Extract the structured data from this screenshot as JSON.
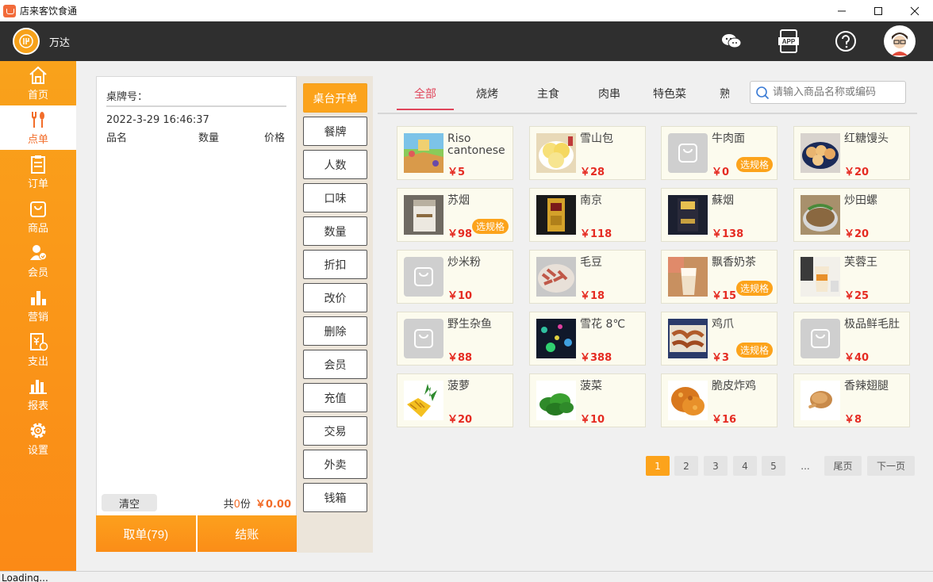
{
  "window": {
    "title": "店来客饮食通"
  },
  "header": {
    "store_name": "万达",
    "icons": [
      "wechat-icon",
      "app-icon",
      "help-icon",
      "avatar"
    ]
  },
  "sidebar": {
    "items": [
      {
        "label": "首页",
        "icon": "home-icon"
      },
      {
        "label": "点单",
        "icon": "cutlery-icon",
        "active": true
      },
      {
        "label": "订单",
        "icon": "clipboard-icon"
      },
      {
        "label": "商品",
        "icon": "bag-icon"
      },
      {
        "label": "会员",
        "icon": "member-icon"
      },
      {
        "label": "营销",
        "icon": "marketing-icon"
      },
      {
        "label": "支出",
        "icon": "expense-icon"
      },
      {
        "label": "报表",
        "icon": "report-icon"
      },
      {
        "label": "设置",
        "icon": "gear-icon"
      }
    ]
  },
  "order": {
    "table_label": "桌牌号：",
    "datetime": "2022-3-29 16:46:37",
    "columns": [
      "品名",
      "数量",
      "价格"
    ],
    "clear_label": "清空",
    "summary_prefix": "共",
    "summary_qty": "0",
    "summary_unit": "份",
    "summary_amount": "￥0.00",
    "take_order_label": "取单(79)",
    "checkout_label": "结账"
  },
  "actions": [
    "桌台开单",
    "餐牌",
    "人数",
    "口味",
    "数量",
    "折扣",
    "改价",
    "删除",
    "会员",
    "充值",
    "交易",
    "外卖",
    "钱箱"
  ],
  "tabs": [
    {
      "label": "全部",
      "active": true
    },
    {
      "label": "烧烤"
    },
    {
      "label": "主食"
    },
    {
      "label": "肉串"
    },
    {
      "label": "特色菜"
    },
    {
      "label": "熟"
    }
  ],
  "search": {
    "placeholder": "请输入商品名称或编码"
  },
  "spec_label": "选规格",
  "products": [
    {
      "name": "Riso cantonese",
      "price": "￥5",
      "spec": false,
      "thumb": "game-scene"
    },
    {
      "name": "雪山包",
      "price": "￥28",
      "spec": false,
      "thumb": "buns"
    },
    {
      "name": "牛肉面",
      "price": "￥0",
      "spec": true,
      "thumb": "placeholder"
    },
    {
      "name": "红糖馒头",
      "price": "￥20",
      "spec": false,
      "thumb": "red-sugar-buns"
    },
    {
      "name": "苏烟",
      "price": "￥98",
      "spec": true,
      "thumb": "cigarette-white"
    },
    {
      "name": "南京",
      "price": "￥118",
      "spec": false,
      "thumb": "cigarette-gold"
    },
    {
      "name": "蘇烟",
      "price": "￥138",
      "spec": false,
      "thumb": "cigarette-dark"
    },
    {
      "name": "炒田螺",
      "price": "￥20",
      "spec": false,
      "thumb": "snails"
    },
    {
      "name": "炒米粉",
      "price": "￥10",
      "spec": false,
      "thumb": "placeholder"
    },
    {
      "name": "毛豆",
      "price": "￥18",
      "spec": false,
      "thumb": "soybeans"
    },
    {
      "name": "飘香奶茶",
      "price": "￥15",
      "spec": true,
      "thumb": "milk-tea"
    },
    {
      "name": "芙蓉王",
      "price": "￥25",
      "spec": false,
      "thumb": "drink-cup"
    },
    {
      "name": "野生杂鱼",
      "price": "￥88",
      "spec": false,
      "thumb": "placeholder"
    },
    {
      "name": "雪花 8℃",
      "price": "￥388",
      "spec": false,
      "thumb": "night-lights"
    },
    {
      "name": "鸡爪",
      "price": "￥3",
      "spec": true,
      "thumb": "chicken-feet"
    },
    {
      "name": "极品鲜毛肚",
      "price": "￥40",
      "spec": false,
      "thumb": "placeholder"
    },
    {
      "name": "菠萝",
      "price": "￥20",
      "spec": false,
      "thumb": "pineapple"
    },
    {
      "name": "菠菜",
      "price": "￥10",
      "spec": false,
      "thumb": "spinach"
    },
    {
      "name": "脆皮炸鸡",
      "price": "￥16",
      "spec": false,
      "thumb": "fried-chicken"
    },
    {
      "name": "香辣翅腿",
      "price": "￥8",
      "spec": false,
      "thumb": "wings"
    }
  ],
  "pagination": {
    "pages": [
      "1",
      "2",
      "3",
      "4",
      "5"
    ],
    "current": "1",
    "ellipsis": "...",
    "last_label": "尾页",
    "next_label": "下一页"
  },
  "status": {
    "text": "Loading..."
  },
  "colors": {
    "accent": "#fca31b",
    "sidebar": "#f9a21b",
    "header": "#2f2f2f",
    "price": "#e52b22",
    "tab_active": "#e0455a"
  }
}
